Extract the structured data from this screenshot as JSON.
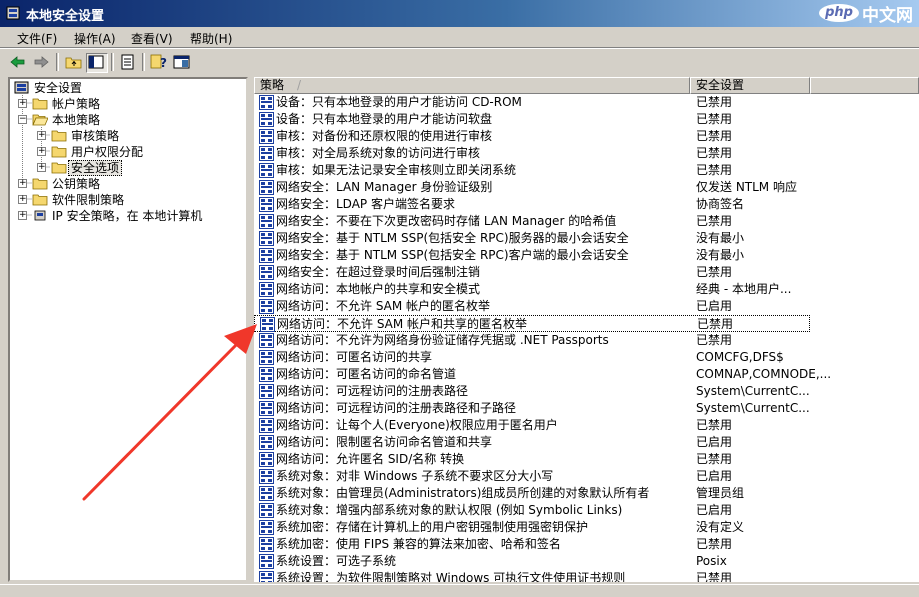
{
  "window": {
    "title": "本地安全设置"
  },
  "watermark": {
    "logo": "php",
    "text": "中文网"
  },
  "menu": [
    {
      "label": "文件(F)"
    },
    {
      "label": "操作(A)"
    },
    {
      "label": "查看(V)"
    },
    {
      "label": "帮助(H)"
    }
  ],
  "toolbar": {
    "buttons": [
      {
        "name": "back-icon"
      },
      {
        "name": "forward-icon"
      },
      {
        "name": "up-folder-icon"
      },
      {
        "name": "show-tree-icon"
      },
      {
        "name": "export-list-icon"
      },
      {
        "name": "help-icon"
      },
      {
        "name": "console-icon"
      }
    ]
  },
  "tree": {
    "root": "安全设置",
    "nodes": [
      {
        "label": "帐户策略"
      },
      {
        "label": "本地策略"
      },
      {
        "label": "审核策略"
      },
      {
        "label": "用户权限分配"
      },
      {
        "label": "安全选项"
      },
      {
        "label": "公钥策略"
      },
      {
        "label": "软件限制策略"
      },
      {
        "label": "IP 安全策略，在 本地计算机"
      }
    ]
  },
  "list": {
    "columns": {
      "policy": "策略",
      "setting": "安全设置",
      "sort_indicator": "/"
    },
    "rows": [
      {
        "policy": "设备：只有本地登录的用户才能访问 CD-ROM",
        "setting": "已禁用"
      },
      {
        "policy": "设备：只有本地登录的用户才能访问软盘",
        "setting": "已禁用"
      },
      {
        "policy": "审核：对备份和还原权限的使用进行审核",
        "setting": "已禁用"
      },
      {
        "policy": "审核：对全局系统对象的访问进行审核",
        "setting": "已禁用"
      },
      {
        "policy": "审核：如果无法记录安全审核则立即关闭系统",
        "setting": "已禁用"
      },
      {
        "policy": "网络安全：LAN Manager 身份验证级别",
        "setting": "仅发送 NTLM 响应"
      },
      {
        "policy": "网络安全：LDAP 客户端签名要求",
        "setting": "协商签名"
      },
      {
        "policy": "网络安全：不要在下次更改密码时存储 LAN Manager 的哈希值",
        "setting": "已禁用"
      },
      {
        "policy": "网络安全：基于 NTLM SSP(包括安全 RPC)服务器的最小会话安全",
        "setting": "没有最小"
      },
      {
        "policy": "网络安全：基于 NTLM SSP(包括安全 RPC)客户端的最小会话安全",
        "setting": "没有最小"
      },
      {
        "policy": "网络安全：在超过登录时间后强制注销",
        "setting": "已禁用"
      },
      {
        "policy": "网络访问：本地帐户的共享和安全模式",
        "setting": "经典 - 本地用户..."
      },
      {
        "policy": "网络访问：不允许 SAM 帐户的匿名枚举",
        "setting": "已启用"
      },
      {
        "policy": "网络访问：不允许 SAM 帐户和共享的匿名枚举",
        "setting": "已禁用"
      },
      {
        "policy": "网络访问：不允许为网络身份验证储存凭据或 .NET Passports",
        "setting": "已禁用"
      },
      {
        "policy": "网络访问：可匿名访问的共享",
        "setting": "COMCFG,DFS$"
      },
      {
        "policy": "网络访问：可匿名访问的命名管道",
        "setting": "COMNAP,COMNODE,..."
      },
      {
        "policy": "网络访问：可远程访问的注册表路径",
        "setting": "System\\CurrentC..."
      },
      {
        "policy": "网络访问：可远程访问的注册表路径和子路径",
        "setting": "System\\CurrentC..."
      },
      {
        "policy": "网络访问：让每个人(Everyone)权限应用于匿名用户",
        "setting": "已禁用"
      },
      {
        "policy": "网络访问：限制匿名访问命名管道和共享",
        "setting": "已启用"
      },
      {
        "policy": "网络访问：允许匿名 SID/名称 转换",
        "setting": "已禁用"
      },
      {
        "policy": "系统对象：对非 Windows 子系统不要求区分大小写",
        "setting": "已启用"
      },
      {
        "policy": "系统对象：由管理员(Administrators)组成员所创建的对象默认所有者",
        "setting": "管理员组"
      },
      {
        "policy": "系统对象：增强内部系统对象的默认权限 (例如 Symbolic Links)",
        "setting": "已启用"
      },
      {
        "policy": "系统加密：存储在计算机上的用户密钥强制使用强密钥保护",
        "setting": "没有定义"
      },
      {
        "policy": "系统加密：使用 FIPS 兼容的算法来加密、哈希和签名",
        "setting": "已禁用"
      },
      {
        "policy": "系统设置：可选子系统",
        "setting": "Posix"
      },
      {
        "policy": "系统设置：为软件限制策略对 Windows 可执行文件使用证书规则",
        "setting": "已禁用"
      }
    ]
  },
  "annotation": {
    "arrow_color": "#f0372a"
  }
}
